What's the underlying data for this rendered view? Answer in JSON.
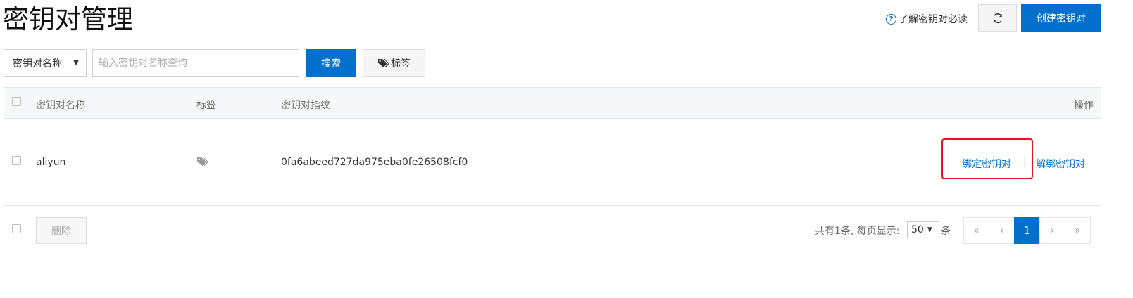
{
  "header": {
    "title": "密钥对管理",
    "help_link": "了解密钥对必读",
    "refresh_icon": "refresh-icon",
    "create_button": "创建密钥对"
  },
  "filter": {
    "field_select": "密钥对名称",
    "search_placeholder": "输入密钥对名称查询",
    "search_button": "搜索",
    "tag_button": "标签"
  },
  "table": {
    "columns": {
      "name": "密钥对名称",
      "tags": "标签",
      "fingerprint": "密钥对指纹",
      "actions": "操作"
    },
    "rows": [
      {
        "name": "aliyun",
        "fingerprint": "0fa6abeed727da975eba0fe26508fcf0",
        "bind_action": "绑定密钥对",
        "separator": "|",
        "unbind_action": "解绑密钥对"
      }
    ]
  },
  "footer": {
    "delete_button": "删除",
    "total_text": "共有1条, 每页显示:",
    "page_size": "50",
    "page_size_suffix": "条",
    "pager": {
      "first": "«",
      "prev": "‹",
      "current": "1",
      "next": "›",
      "last": "»"
    }
  },
  "colors": {
    "primary": "#0070cc",
    "highlight": "#e5141e"
  }
}
